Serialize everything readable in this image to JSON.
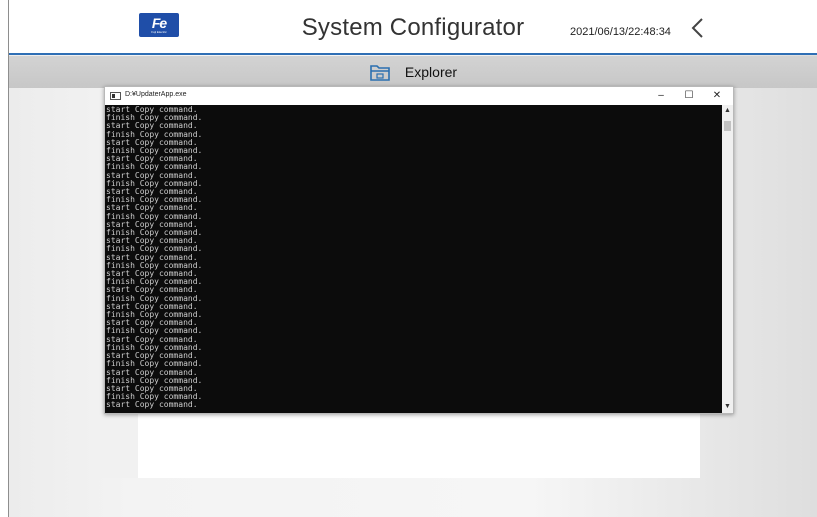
{
  "header": {
    "logo": {
      "icon": "fuji-electric-logo",
      "text": "Fe",
      "subtext": "Fuji Electric",
      "color": "#1f4ea8"
    },
    "title": "System Configurator",
    "datetime": "2021/06/13/22:48:34",
    "back_icon": "chevron-left-icon"
  },
  "toolbar": {
    "icon": "folder-icon",
    "label": "Explorer"
  },
  "console": {
    "title": "D:¥UpdaterApp.exe",
    "minimize_label": "–",
    "maximize_label": "☐",
    "close_label": "✕",
    "scroll_up_label": "▲",
    "scroll_down_label": "▼",
    "lines": [
      "start Copy command.",
      "finish Copy command.",
      "start Copy command.",
      "finish Copy command.",
      "start Copy command.",
      "finish Copy command.",
      "start Copy command.",
      "finish Copy command.",
      "start Copy command.",
      "finish Copy command.",
      "start Copy command.",
      "finish Copy command.",
      "start Copy command.",
      "finish Copy command.",
      "start Copy command.",
      "finish Copy command.",
      "start Copy command.",
      "finish Copy command.",
      "start Copy command.",
      "finish Copy command.",
      "start Copy command.",
      "finish Copy command.",
      "start Copy command.",
      "finish Copy command.",
      "start Copy command.",
      "finish Copy command.",
      "start Copy command.",
      "finish Copy command.",
      "start Copy command.",
      "finish Copy command.",
      "start Copy command.",
      "finish Copy command.",
      "start Copy command.",
      "finish Copy command.",
      "start Copy command.",
      "finish Copy command.",
      "start Copy command."
    ]
  },
  "colors": {
    "accent": "#2f6fb5",
    "console_bg": "#0c0c0c",
    "console_text": "#cfcfcf"
  }
}
